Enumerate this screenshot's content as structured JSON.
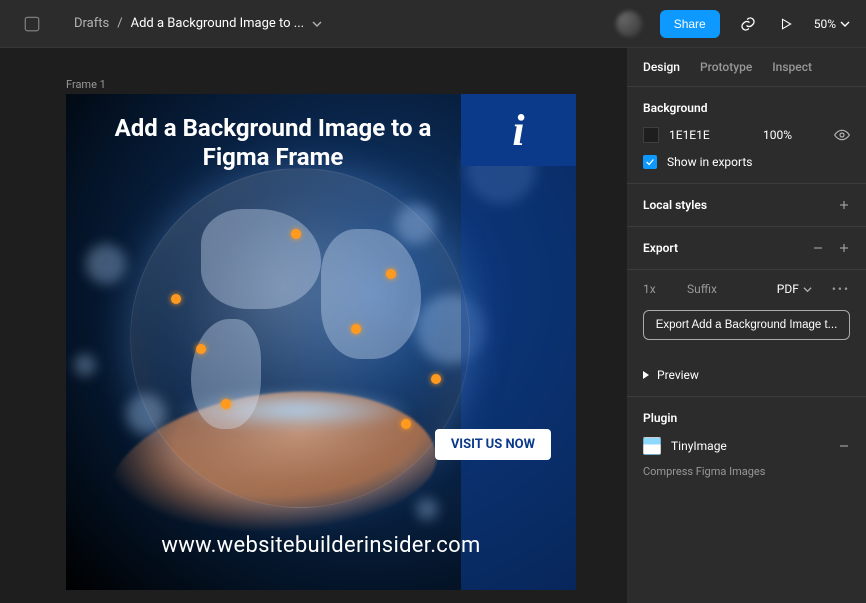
{
  "breadcrumb": {
    "root": "Drafts",
    "current": "Add a Background Image to ..."
  },
  "topbar": {
    "share": "Share",
    "zoom": "50%"
  },
  "canvas": {
    "frame_label": "Frame 1",
    "headline": "Add a Background Image to a Figma Frame",
    "cta": "VISIT US NOW",
    "url": "www.websitebuilderinsider.com",
    "corner_char": "i"
  },
  "panel": {
    "tabs": [
      "Design",
      "Prototype",
      "Inspect"
    ],
    "active_tab": "Design",
    "background": {
      "title": "Background",
      "hex": "1E1E1E",
      "opacity": "100%",
      "show_in_exports": "Show in exports"
    },
    "local_styles": "Local styles",
    "export": {
      "title": "Export",
      "size": "1x",
      "suffix": "Suffix",
      "format": "PDF",
      "button": "Export Add a Background Image t...",
      "preview": "Preview"
    },
    "plugin": {
      "title": "Plugin",
      "name": "TinyImage",
      "desc": "Compress Figma Images"
    }
  }
}
